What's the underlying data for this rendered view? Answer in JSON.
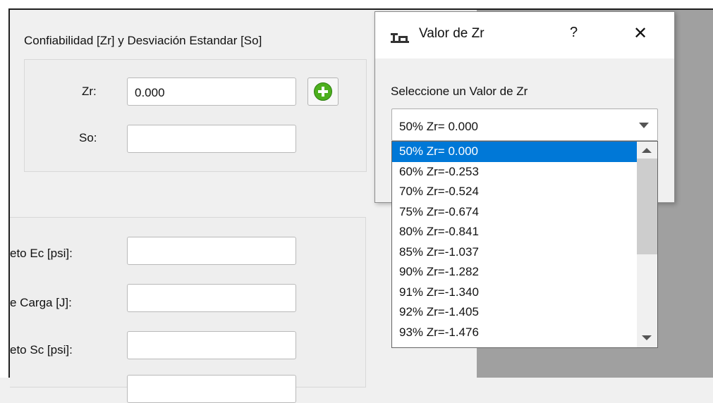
{
  "form": {
    "group_title": "Confiabilidad [Zr] y Desviación Estandar [So]",
    "zr_label": "Zr:",
    "zr_value": "0.000",
    "so_label": "So:",
    "so_value": "",
    "ec_label": "eto Ec [psi]:",
    "j_label": "e Carga [J]:",
    "sc_label": "eto  Sc [psi]:"
  },
  "dialog": {
    "title": "Valor de Zr",
    "help_glyph": "?",
    "close_glyph": "✕",
    "label": "Seleccione un Valor de Zr",
    "selected": "50% Zr= 0.000",
    "options": [
      "50% Zr= 0.000",
      "60% Zr=-0.253",
      "70% Zr=-0.524",
      "75% Zr=-0.674",
      "80% Zr=-0.841",
      "85% Zr=-1.037",
      "90% Zr=-1.282",
      "91% Zr=-1.340",
      "92% Zr=-1.405",
      "93% Zr=-1.476"
    ],
    "highlighted_index": 0
  },
  "colors": {
    "accent": "#0078d7",
    "add_icon": "#4caf1d",
    "background_area": "#a0a0a0"
  },
  "icons": {
    "add": "plus-circle-icon",
    "app": "app-logo-icon",
    "combo_arrow": "chevron-down-icon"
  }
}
